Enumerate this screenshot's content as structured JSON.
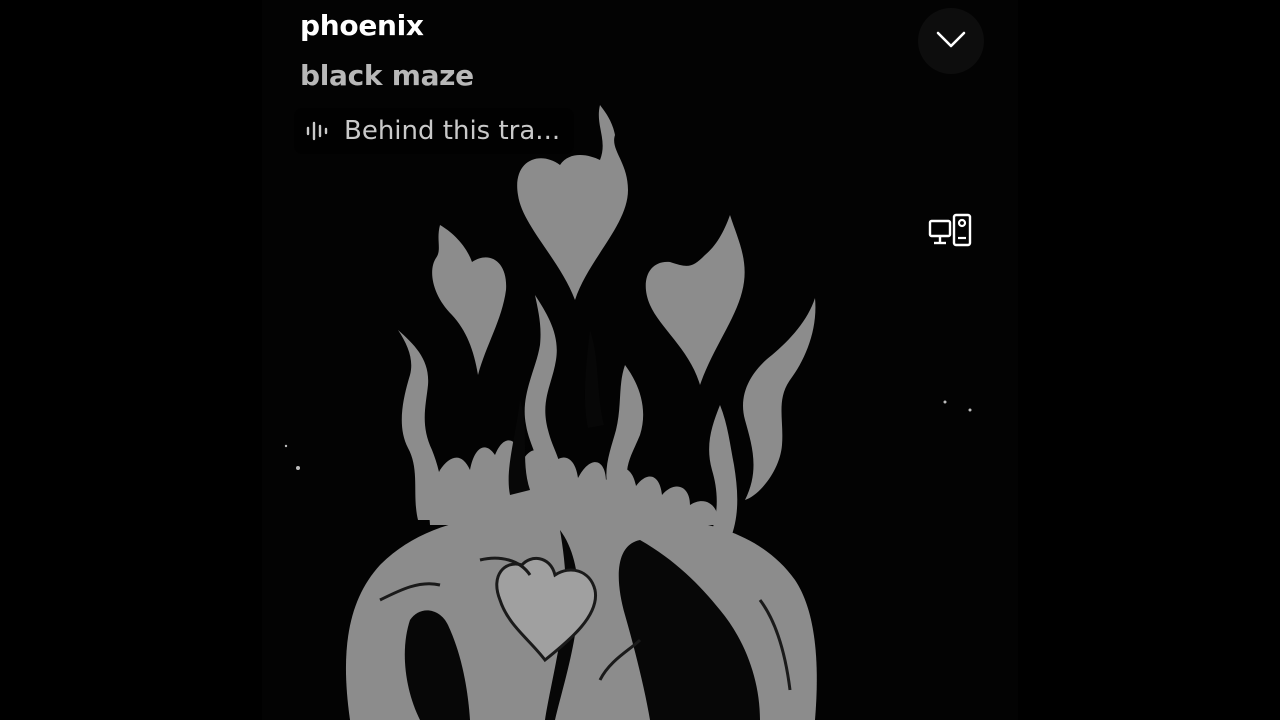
{
  "now_playing": {
    "title": "phoenix",
    "artist": "black maze",
    "behind_the_track_label": "Behind this tra..."
  },
  "icons": {
    "collapse": "chevron-down-icon",
    "devices": "connect-devices-icon",
    "behind_track": "sound-wave-icon"
  },
  "colors": {
    "background": "#000000",
    "title": "#ffffff",
    "artist": "#b8b8b8",
    "artwork_gray": "#8c8c8c"
  }
}
